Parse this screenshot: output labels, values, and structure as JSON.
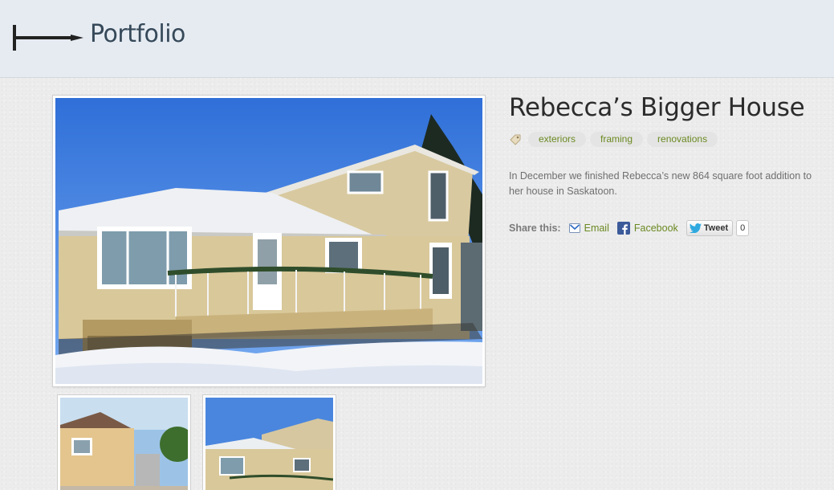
{
  "header": {
    "back_icon": "back-arrow-icon",
    "title": "Portfolio"
  },
  "project": {
    "title": "Rebecca’s Bigger House",
    "tag_icon": "tag-icon",
    "tags": [
      "exteriors",
      "framing",
      "renovations"
    ],
    "description": "In December we finished Rebecca’s new 864 square foot addition to her house in Saskatoon."
  },
  "share": {
    "label": "Share this:",
    "email": "Email",
    "facebook": "Facebook",
    "tweet": "Tweet",
    "tweet_count": "0"
  },
  "gallery": {
    "main_photo": "house-photo-winter",
    "thumbnails": [
      "house-photo-side",
      "house-photo-front"
    ]
  },
  "colors": {
    "header_bg": "#e6ebf2",
    "title": "#364959",
    "link": "#6b8a22"
  }
}
